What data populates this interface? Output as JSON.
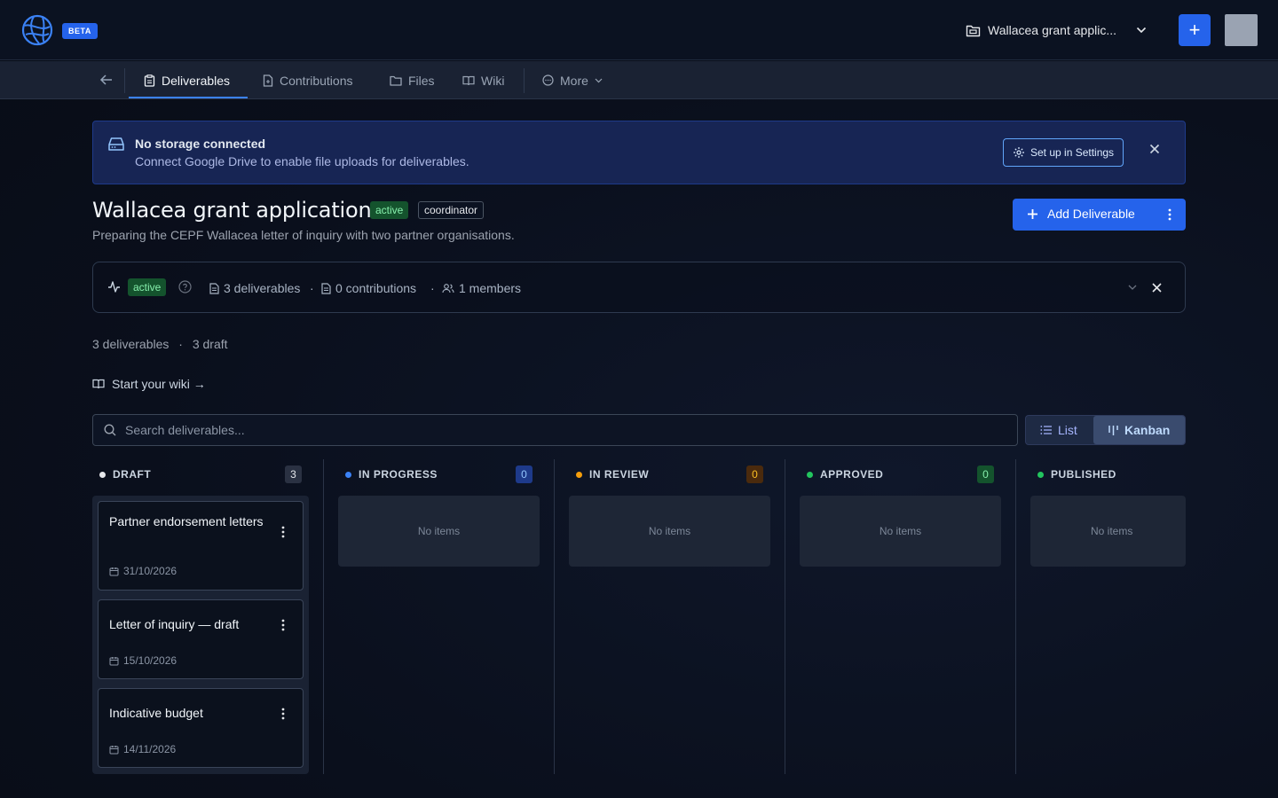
{
  "topbar": {
    "beta_label": "BETA",
    "project_name": "Wallacea grant applic...",
    "new_button_label": "+"
  },
  "tabs": [
    {
      "label": "Deliverables",
      "icon": "clipboard-icon",
      "active": true
    },
    {
      "label": "Contributions",
      "icon": "file-icon"
    },
    {
      "label": "Files",
      "icon": "folder-icon"
    },
    {
      "label": "Wiki",
      "icon": "book-icon"
    },
    {
      "label": "More",
      "icon": "circle-dots-icon"
    }
  ],
  "banner": {
    "title": "No storage connected",
    "subtitle": "Connect Google Drive to enable file uploads for deliverables.",
    "settings_label": "Set up in Settings"
  },
  "project": {
    "title": "Wallacea grant application",
    "status": "active",
    "role": "coordinator",
    "description": "Preparing the CEPF Wallacea letter of inquiry with two partner organisations.",
    "add_label": "Add Deliverable"
  },
  "stats": {
    "status": "active",
    "deliverables": "3 deliverables",
    "contributions": "0 contributions",
    "members": "1 members",
    "separator": "·"
  },
  "summary": {
    "deliverables": "3 deliverables",
    "separator": "·",
    "draft": "3 draft"
  },
  "wiki_link": "Start your wiki →",
  "search": {
    "placeholder": "Search deliverables..."
  },
  "view_toggle": {
    "list": "List",
    "kanban": "Kanban",
    "selected": "Kanban"
  },
  "columns": [
    {
      "label": "DRAFT",
      "count": "3",
      "color": "#e5e7eb"
    },
    {
      "label": "IN PROGRESS",
      "count": "0",
      "color": "#3b82f6",
      "empty": "No items"
    },
    {
      "label": "IN REVIEW",
      "count": "0",
      "color": "#f59e0b",
      "empty": "No items"
    },
    {
      "label": "APPROVED",
      "count": "0",
      "color": "#22c55e",
      "empty": "No items"
    },
    {
      "label": "PUBLISHED",
      "count": "",
      "color": "#22c55e",
      "empty": "No items"
    }
  ],
  "cards": [
    {
      "title": "Partner endorsement letters",
      "date": "31/10/2026"
    },
    {
      "title": "Letter of inquiry — draft",
      "date": "15/10/2026"
    },
    {
      "title": "Indicative budget",
      "date": "14/11/2026"
    }
  ]
}
